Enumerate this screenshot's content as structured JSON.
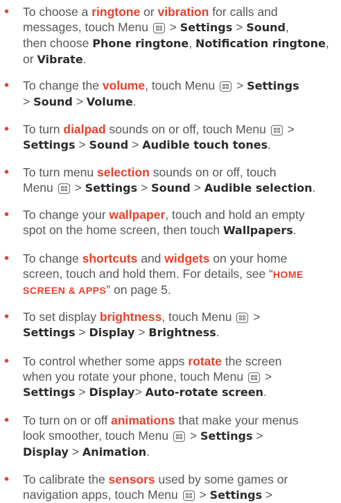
{
  "items": [
    {
      "lines": [
        [
          {
            "t": "To choose a "
          },
          {
            "t": "ringtone",
            "s": "kw"
          },
          {
            "t": " or "
          },
          {
            "t": "vibration",
            "s": "kw"
          },
          {
            "t": " for calls and"
          }
        ],
        [
          {
            "t": "messages, touch Menu "
          },
          {
            "icon": "menu"
          },
          {
            "t": " > "
          },
          {
            "t": "Settings",
            "s": "b"
          },
          {
            "t": " > "
          },
          {
            "t": "Sound",
            "s": "b"
          },
          {
            "t": ","
          }
        ],
        [
          {
            "t": "then choose "
          },
          {
            "t": "Phone ringtone",
            "s": "b"
          },
          {
            "t": ", "
          },
          {
            "t": "Notification ringtone",
            "s": "b"
          },
          {
            "t": ","
          }
        ],
        [
          {
            "t": "or "
          },
          {
            "t": "Vibrate",
            "s": "b"
          },
          {
            "t": "."
          }
        ]
      ]
    },
    {
      "lines": [
        [
          {
            "t": "To change the "
          },
          {
            "t": "volume",
            "s": "kw"
          },
          {
            "t": ", touch Menu "
          },
          {
            "icon": "menu"
          },
          {
            "t": " > "
          },
          {
            "t": "Settings",
            "s": "b"
          }
        ],
        [
          {
            "t": "> "
          },
          {
            "t": "Sound",
            "s": "b"
          },
          {
            "t": " > "
          },
          {
            "t": "Volume",
            "s": "b"
          },
          {
            "t": "."
          }
        ]
      ]
    },
    {
      "lines": [
        [
          {
            "t": "To turn "
          },
          {
            "t": "dialpad",
            "s": "kw"
          },
          {
            "t": " sounds on or off, touch Menu "
          },
          {
            "icon": "menu"
          },
          {
            "t": " >"
          }
        ],
        [
          {
            "t": "Settings",
            "s": "b"
          },
          {
            "t": " > "
          },
          {
            "t": "Sound",
            "s": "b"
          },
          {
            "t": " > "
          },
          {
            "t": "Audible touch tones",
            "s": "b"
          },
          {
            "t": "."
          }
        ]
      ]
    },
    {
      "lines": [
        [
          {
            "t": "To turn menu "
          },
          {
            "t": "selection",
            "s": "kw"
          },
          {
            "t": " sounds on or off, touch"
          }
        ],
        [
          {
            "t": "Menu "
          },
          {
            "icon": "menu"
          },
          {
            "t": " > "
          },
          {
            "t": "Settings",
            "s": "b"
          },
          {
            "t": " > "
          },
          {
            "t": "Sound",
            "s": "b"
          },
          {
            "t": " > "
          },
          {
            "t": "Audible selection",
            "s": "b"
          },
          {
            "t": "."
          }
        ]
      ]
    },
    {
      "lines": [
        [
          {
            "t": "To change your "
          },
          {
            "t": "wallpaper",
            "s": "kw"
          },
          {
            "t": ", touch and hold an empty"
          }
        ],
        [
          {
            "t": "spot on the home screen, then touch "
          },
          {
            "t": "Wallpapers",
            "s": "b"
          },
          {
            "t": "."
          }
        ]
      ]
    },
    {
      "lines": [
        [
          {
            "t": "To change "
          },
          {
            "t": "shortcuts",
            "s": "kw"
          },
          {
            "t": " and "
          },
          {
            "t": "widgets",
            "s": "kw"
          },
          {
            "t": " on your home"
          }
        ],
        [
          {
            "t": "screen, touch and hold them. For details, see “"
          },
          {
            "t": "HOME",
            "s": "caps"
          }
        ],
        [
          {
            "t": "SCREEN & APPS",
            "s": "caps"
          },
          {
            "t": "” on page 5."
          }
        ]
      ]
    },
    {
      "lines": [
        [
          {
            "t": "To set display "
          },
          {
            "t": "brightness",
            "s": "kw"
          },
          {
            "t": ", touch Menu "
          },
          {
            "icon": "menu"
          },
          {
            "t": " >"
          }
        ],
        [
          {
            "t": "Settings",
            "s": "b"
          },
          {
            "t": " > "
          },
          {
            "t": "Display",
            "s": "b"
          },
          {
            "t": " > "
          },
          {
            "t": "Brightness",
            "s": "b"
          },
          {
            "t": "."
          }
        ]
      ]
    },
    {
      "lines": [
        [
          {
            "t": "To control whether some apps "
          },
          {
            "t": "rotate",
            "s": "kw"
          },
          {
            "t": " the screen"
          }
        ],
        [
          {
            "t": "when you rotate your phone, touch Menu "
          },
          {
            "icon": "menu"
          },
          {
            "t": " >"
          }
        ],
        [
          {
            "t": "Settings",
            "s": "b"
          },
          {
            "t": " > "
          },
          {
            "t": "Display",
            "s": "b"
          },
          {
            "t": ">  "
          },
          {
            "t": "Auto-rotate screen",
            "s": "b"
          },
          {
            "t": "."
          }
        ]
      ]
    },
    {
      "lines": [
        [
          {
            "t": "To turn on or off "
          },
          {
            "t": "animations",
            "s": "kw"
          },
          {
            "t": " that make your menus"
          }
        ],
        [
          {
            "t": "look smoother, touch Menu "
          },
          {
            "icon": "menu"
          },
          {
            "t": " > "
          },
          {
            "t": "Settings",
            "s": "b"
          },
          {
            "t": " >"
          }
        ],
        [
          {
            "t": "Display",
            "s": "b"
          },
          {
            "t": " > "
          },
          {
            "t": "Animation",
            "s": "b"
          },
          {
            "t": "."
          }
        ]
      ]
    },
    {
      "lines": [
        [
          {
            "t": "To calibrate the "
          },
          {
            "t": "sensors",
            "s": "kw"
          },
          {
            "t": " used by some games or"
          }
        ],
        [
          {
            "t": "navigation apps, touch Menu "
          },
          {
            "icon": "menu"
          },
          {
            "t": " > "
          },
          {
            "t": "Settings",
            "s": "b"
          },
          {
            "t": " >"
          }
        ]
      ]
    }
  ],
  "bullet": "•",
  "colors": {
    "keyword": "#e8402c",
    "text": "#575757",
    "bold": "#2b2b2b"
  },
  "icon_name": "menu-icon"
}
